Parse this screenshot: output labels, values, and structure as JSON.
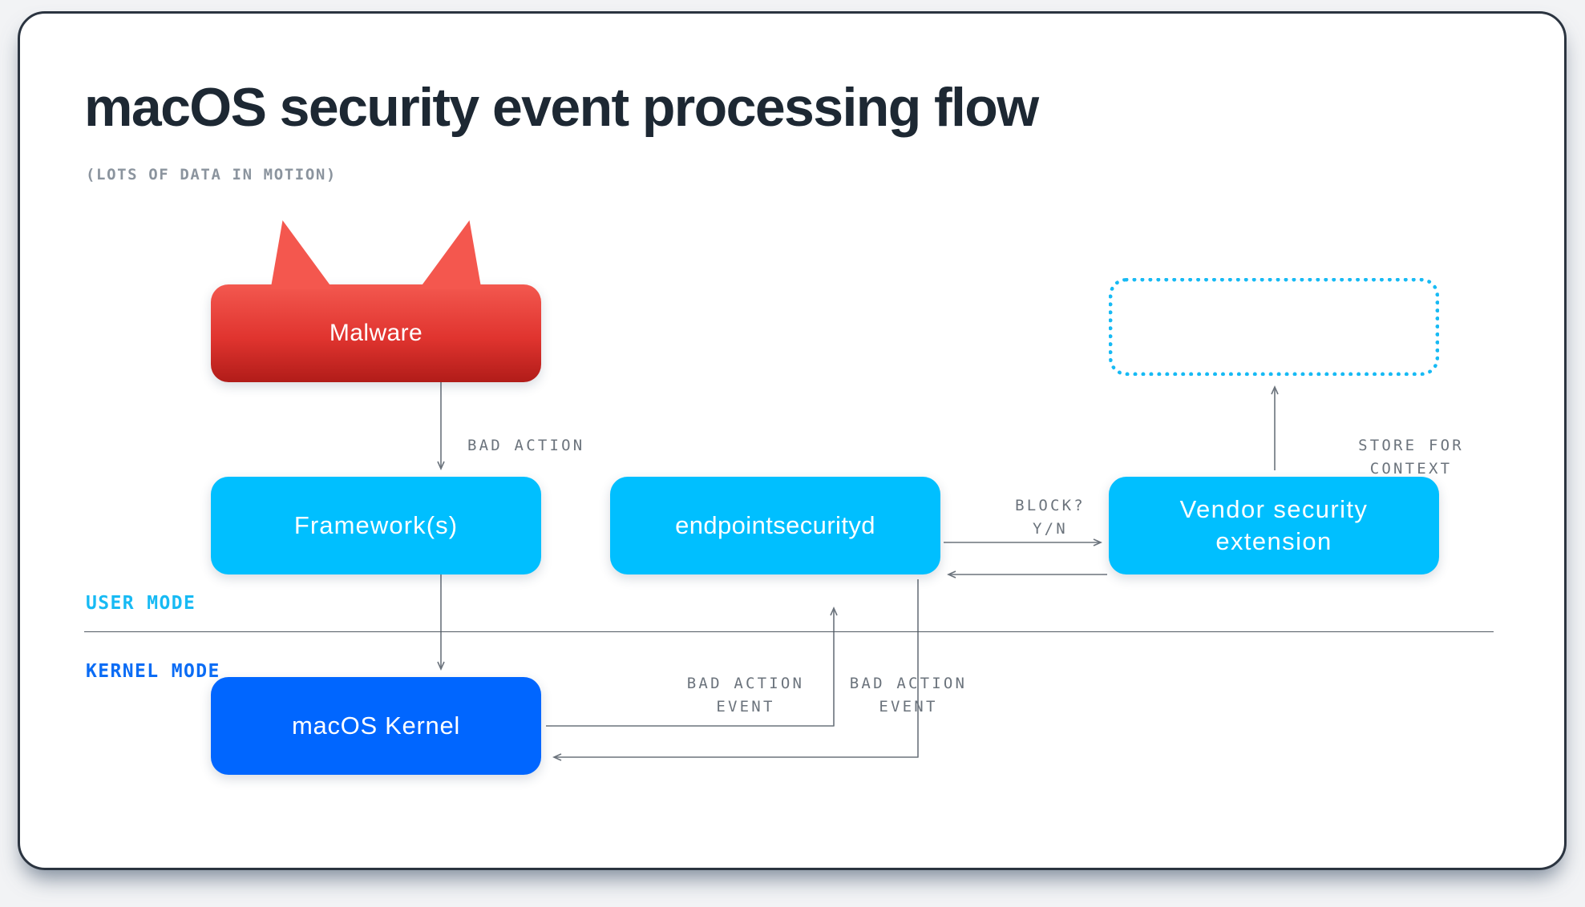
{
  "header": {
    "title": "macOS security event processing flow",
    "subtitle": "(LOTS OF DATA IN MOTION)"
  },
  "theme": {
    "page_background": "#f2f3f5",
    "card_background": "#ffffff",
    "card_border": "#2b3440",
    "title_color": "#1d2833",
    "subtitle_color": "#8b949e",
    "user_mode_color": "#17baf4",
    "kernel_mode_color": "#0a6cf5",
    "cyan_node": "#00bfff",
    "blue_node": "#0066ff",
    "malware_gradient_top": "#f3584f",
    "malware_gradient_bottom": "#b11c19",
    "dotted_border": "#17baf4",
    "edge_color": "#6b737c",
    "divider_color": "#515962"
  },
  "nodes": {
    "malware": {
      "label": "Malware",
      "style": "red-gradient-horned"
    },
    "frameworks": {
      "label": "Framework(s)",
      "style": "cyan"
    },
    "endpointsecurityd": {
      "label": "endpointsecurityd",
      "style": "cyan"
    },
    "vendor_extension": {
      "label": "Vendor security\nextension",
      "style": "cyan"
    },
    "kernel": {
      "label": "macOS Kernel",
      "style": "blue"
    },
    "context_store": {
      "label": "",
      "style": "cyan-dotted-empty"
    }
  },
  "bands": {
    "user_mode": "USER MODE",
    "kernel_mode": "KERNEL MODE"
  },
  "edges": {
    "malware_to_frameworks": "BAD ACTION",
    "endpointsecurityd_to_vendor": "BLOCK?\nY/N",
    "vendor_to_context_store": "STORE FOR\nCONTEXT",
    "kernel_to_endpointsecurityd": "BAD ACTION\nEVENT",
    "endpointsecurityd_to_kernel": "BAD ACTION\nEVENT"
  }
}
